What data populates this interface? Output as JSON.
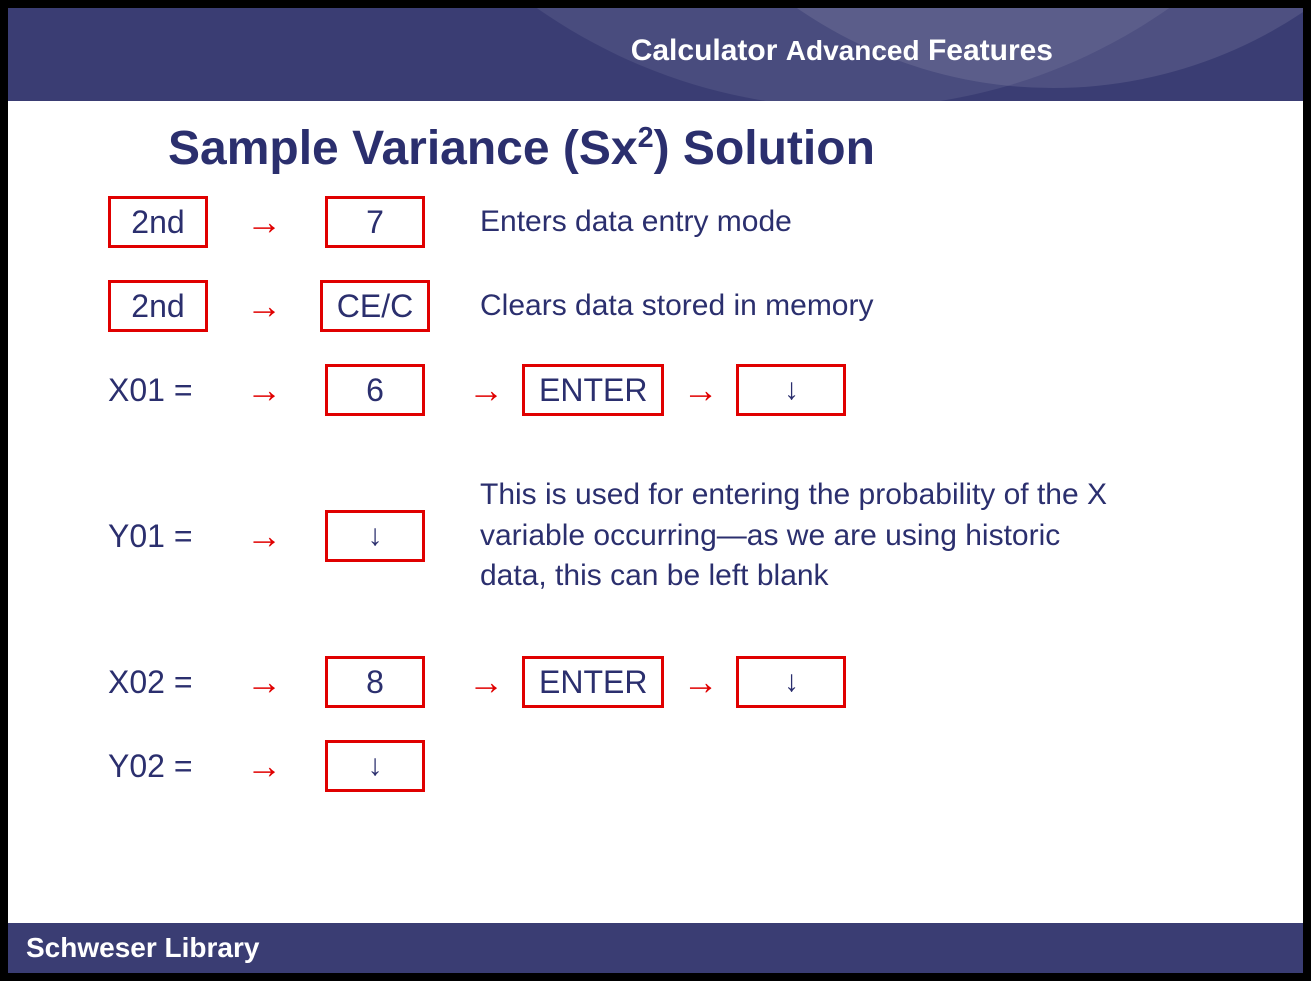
{
  "header": {
    "w1": "Calculator",
    "w2": "Advanced",
    "w3": "Features"
  },
  "title": {
    "pre": "Sample Variance (Sx",
    "sup": "2",
    "post": ") Solution"
  },
  "rows": {
    "r1": {
      "key1": "2nd",
      "key2": "7",
      "desc": "Enters data entry mode"
    },
    "r2": {
      "key1": "2nd",
      "key2": "CE/C",
      "desc": "Clears data stored in memory"
    },
    "r3": {
      "label": "X01 =",
      "key2": "6",
      "enter": "ENTER",
      "down": "↓"
    },
    "r4": {
      "label": "Y01 =",
      "down": "↓",
      "desc": "This is used for entering the probability of the X variable occurring—as we are using historic data, this can be left blank"
    },
    "r5": {
      "label": "X02 =",
      "key2": "8",
      "enter": "ENTER",
      "down": "↓"
    },
    "r6": {
      "label": "Y02 =",
      "down": "↓"
    }
  },
  "footer": "Schweser Library",
  "glyphs": {
    "rarrow": "→"
  }
}
